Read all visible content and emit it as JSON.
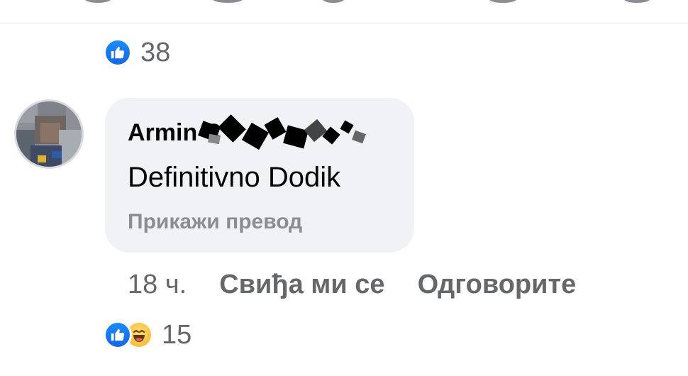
{
  "post_reactions": {
    "count": "38",
    "types": [
      "like-icon"
    ]
  },
  "comment": {
    "author": "Armin C",
    "text": "Definitivno Dodik",
    "translate_label": "Прикажи превод",
    "time": "18 ч.",
    "like_label": "Свиђа ми се",
    "reply_label": "Одговорите",
    "reactions": {
      "count": "15",
      "types": [
        "like-icon",
        "haha-icon"
      ]
    }
  },
  "colors": {
    "like_blue": "#1877f2",
    "bubble_bg": "#f0f2f5",
    "muted_text": "#65676b",
    "haha_yellow": "#f7c33f"
  }
}
